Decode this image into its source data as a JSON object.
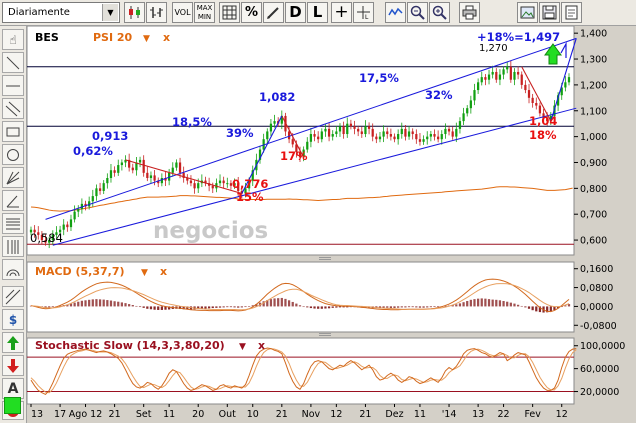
{
  "toolbar": {
    "period": "Diariamente",
    "vol": "VOL",
    "maxmin": "MAX MIN",
    "pct": "%",
    "d": "D",
    "l": "L"
  },
  "colors": {
    "up": "#11a011",
    "down": "#c82020",
    "channel": "#1a1adc",
    "psi": "#e06a10",
    "ref": "#9a1020",
    "anno_blue": "#1a1adc",
    "anno_red": "#e81010"
  },
  "chart_data": [
    {
      "type": "candlestick",
      "panel": "price",
      "title": "BES",
      "overlay_title": "PSI 20",
      "x_ticks": [
        "13",
        "17",
        "Ago 12",
        "21",
        "Set",
        "11",
        "20",
        "Out",
        "10",
        "21",
        "Nov",
        "12",
        "21",
        "Dez",
        "11",
        "'14",
        "13",
        "22",
        "Fev",
        "12"
      ],
      "y_ticks": [
        "0,600",
        "0,700",
        "0,800",
        "0,900",
        "1,000",
        "1,100",
        "1,200",
        "1,300",
        "1,400"
      ],
      "ylim": [
        0.55,
        1.42
      ],
      "close": [
        0.64,
        0.63,
        0.62,
        0.6,
        0.59,
        0.6,
        0.62,
        0.63,
        0.64,
        0.66,
        0.65,
        0.68,
        0.71,
        0.72,
        0.74,
        0.73,
        0.75,
        0.77,
        0.8,
        0.79,
        0.82,
        0.84,
        0.87,
        0.86,
        0.89,
        0.9,
        0.91,
        0.88,
        0.87,
        0.9,
        0.91,
        0.86,
        0.84,
        0.85,
        0.83,
        0.82,
        0.84,
        0.83,
        0.86,
        0.88,
        0.9,
        0.86,
        0.84,
        0.83,
        0.82,
        0.8,
        0.82,
        0.83,
        0.82,
        0.81,
        0.8,
        0.82,
        0.83,
        0.82,
        0.82,
        0.81,
        0.82,
        0.79,
        0.78,
        0.8,
        0.83,
        0.87,
        0.91,
        0.95,
        0.99,
        1.02,
        1.05,
        1.06,
        1.05,
        1.08,
        1.02,
        0.99,
        0.97,
        0.94,
        0.92,
        0.95,
        0.98,
        1.01,
        1.0,
        0.99,
        1.02,
        1.03,
        1.0,
        1.01,
        1.02,
        1.04,
        1.01,
        1.05,
        1.04,
        1.03,
        1.02,
        1.01,
        1.04,
        1.03,
        1.0,
        0.99,
        1.0,
        1.02,
        1.01,
        1.0,
        0.99,
        1.01,
        1.03,
        1.0,
        1.02,
        1.01,
        0.99,
        0.98,
        0.99,
        1.0,
        1.01,
        1.0,
        0.99,
        1.01,
        1.03,
        1.02,
        1.0,
        1.03,
        1.06,
        1.09,
        1.11,
        1.14,
        1.18,
        1.21,
        1.23,
        1.22,
        1.24,
        1.25,
        1.22,
        1.24,
        1.26,
        1.27,
        1.22,
        1.25,
        1.24,
        1.2,
        1.18,
        1.15,
        1.13,
        1.12,
        1.09,
        1.07,
        1.06,
        1.08,
        1.12,
        1.16,
        1.19,
        1.21,
        1.23
      ],
      "overlay": [
        0.728,
        0.727,
        0.725,
        0.722,
        0.719,
        0.716,
        0.714,
        0.713,
        0.712,
        0.713,
        0.713,
        0.714,
        0.716,
        0.718,
        0.72,
        0.723,
        0.725,
        0.728,
        0.731,
        0.734,
        0.736,
        0.739,
        0.742,
        0.744,
        0.747,
        0.749,
        0.752,
        0.754,
        0.757,
        0.759,
        0.762,
        0.764,
        0.766,
        0.766,
        0.766,
        0.766,
        0.767,
        0.767,
        0.768,
        0.769,
        0.77,
        0.772,
        0.772,
        0.772,
        0.771,
        0.771,
        0.77,
        0.769,
        0.768,
        0.767,
        0.766,
        0.765,
        0.765,
        0.764,
        0.763,
        0.762,
        0.761,
        0.759,
        0.758,
        0.757,
        0.757,
        0.757,
        0.757,
        0.757,
        0.757,
        0.758,
        0.758,
        0.758,
        0.758,
        0.758,
        0.758,
        0.759,
        0.758,
        0.758,
        0.757,
        0.756,
        0.756,
        0.755,
        0.754,
        0.753,
        0.754,
        0.755,
        0.756,
        0.757,
        0.757,
        0.758,
        0.76,
        0.761,
        0.761,
        0.761,
        0.761,
        0.762,
        0.763,
        0.764,
        0.764,
        0.765,
        0.766,
        0.768,
        0.769,
        0.771,
        0.772,
        0.773,
        0.774,
        0.775,
        0.776,
        0.777,
        0.778,
        0.779,
        0.78,
        0.781,
        0.782,
        0.783,
        0.784,
        0.785,
        0.787,
        0.788,
        0.789,
        0.79,
        0.791,
        0.792,
        0.793,
        0.794,
        0.795,
        0.796,
        0.797,
        0.799,
        0.801,
        0.803,
        0.805,
        0.806,
        0.806,
        0.806,
        0.805,
        0.805,
        0.804,
        0.803,
        0.802,
        0.801,
        0.8,
        0.798,
        0.796,
        0.794,
        0.792,
        0.792,
        0.792,
        0.793,
        0.794,
        0.795,
        0.798,
        0.801
      ],
      "levels": [
        0.584,
        1.04,
        1.27
      ],
      "annotations": {
        "low": "0,584",
        "a_913": "0,913",
        "a_062": "0,62%",
        "a_185": "18,5%",
        "a_39": "39%",
        "a_1082": "1,082",
        "a_175": "17,5%",
        "a_32": "32%",
        "a_1270": "1,270",
        "a_target": "+18%=1,497",
        "a_776": "0,776",
        "a_15": "15%",
        "a_17": "17%",
        "a_104": "1,04",
        "a_18": "18%"
      },
      "watermark": "negocios"
    },
    {
      "type": "histogram",
      "panel": "macd",
      "title": "MACD (5,37,7)",
      "y_ticks": [
        "0,1600",
        "0,0800",
        "0,0000",
        "-0,0800"
      ],
      "ylim": [
        -0.1,
        0.18
      ],
      "hist": [
        0.003,
        0.001,
        -0.002,
        -0.004,
        -0.005,
        -0.004,
        -0.002,
        0.0,
        0.003,
        0.006,
        0.008,
        0.012,
        0.016,
        0.02,
        0.024,
        0.026,
        0.028,
        0.03,
        0.031,
        0.03,
        0.029,
        0.027,
        0.025,
        0.022,
        0.02,
        0.017,
        0.014,
        0.01,
        0.006,
        0.002,
        -0.002,
        -0.006,
        -0.01,
        -0.012,
        -0.014,
        -0.015,
        -0.015,
        -0.014,
        -0.013,
        -0.011,
        -0.01,
        -0.011,
        -0.012,
        -0.013,
        -0.013,
        -0.012,
        -0.011,
        -0.01,
        -0.009,
        -0.008,
        -0.007,
        -0.006,
        -0.005,
        -0.004,
        -0.003,
        -0.003,
        -0.004,
        -0.005,
        -0.004,
        -0.002,
        0.001,
        0.005,
        0.01,
        0.016,
        0.022,
        0.027,
        0.031,
        0.034,
        0.035,
        0.036,
        0.032,
        0.026,
        0.019,
        0.012,
        0.005,
        0.0,
        -0.004,
        -0.007,
        -0.009,
        -0.01,
        -0.01,
        -0.009,
        -0.008,
        -0.006,
        -0.005,
        -0.004,
        -0.004,
        -0.004,
        -0.003,
        -0.003,
        -0.004,
        -0.005,
        -0.005,
        -0.006,
        -0.007,
        -0.007,
        -0.006,
        -0.005,
        -0.005,
        -0.006,
        -0.006,
        -0.005,
        -0.004,
        -0.004,
        -0.003,
        -0.003,
        -0.004,
        -0.005,
        -0.005,
        -0.004,
        -0.003,
        -0.002,
        -0.001,
        0.0,
        0.002,
        0.004,
        0.006,
        0.009,
        0.013,
        0.018,
        0.023,
        0.028,
        0.031,
        0.033,
        0.034,
        0.033,
        0.031,
        0.029,
        0.028,
        0.026,
        0.023,
        0.02,
        0.016,
        0.012,
        0.007,
        0.002,
        -0.004,
        -0.01,
        -0.016,
        -0.021,
        -0.024,
        -0.026,
        -0.025,
        -0.021,
        -0.015,
        -0.008,
        -0.002,
        0.004,
        0.01
      ],
      "macd_line": [
        0.004,
        0.0,
        -0.004,
        -0.008,
        -0.01,
        -0.009,
        -0.006,
        -0.002,
        0.004,
        0.011,
        0.018,
        0.027,
        0.038,
        0.05,
        0.062,
        0.072,
        0.081,
        0.089,
        0.096,
        0.1,
        0.102,
        0.103,
        0.102,
        0.099,
        0.095,
        0.09,
        0.083,
        0.075,
        0.066,
        0.057,
        0.047,
        0.038,
        0.029,
        0.021,
        0.014,
        0.008,
        0.003,
        0.0,
        -0.003,
        -0.005,
        -0.006,
        -0.008,
        -0.01,
        -0.012,
        -0.014,
        -0.015,
        -0.016,
        -0.017,
        -0.017,
        -0.018,
        -0.018,
        -0.018,
        -0.018,
        -0.017,
        -0.017,
        -0.017,
        -0.018,
        -0.019,
        -0.018,
        -0.015,
        -0.01,
        -0.002,
        0.009,
        0.022,
        0.037,
        0.052,
        0.065,
        0.077,
        0.087,
        0.095,
        0.098,
        0.097,
        0.092,
        0.084,
        0.074,
        0.063,
        0.052,
        0.042,
        0.033,
        0.025,
        0.018,
        0.012,
        0.008,
        0.005,
        0.003,
        0.002,
        0.001,
        0.001,
        0.0,
        -0.001,
        -0.002,
        -0.004,
        -0.005,
        -0.007,
        -0.009,
        -0.011,
        -0.012,
        -0.013,
        -0.013,
        -0.014,
        -0.014,
        -0.014,
        -0.013,
        -0.013,
        -0.012,
        -0.012,
        -0.012,
        -0.012,
        -0.012,
        -0.011,
        -0.01,
        -0.008,
        -0.005,
        -0.001,
        0.004,
        0.01,
        0.018,
        0.027,
        0.038,
        0.05,
        0.063,
        0.076,
        0.088,
        0.098,
        0.106,
        0.112,
        0.115,
        0.116,
        0.115,
        0.112,
        0.108,
        0.102,
        0.095,
        0.086,
        0.076,
        0.064,
        0.051,
        0.037,
        0.022,
        0.008,
        -0.005,
        -0.015,
        -0.021,
        -0.022,
        -0.017,
        -0.008,
        0.004,
        0.017,
        0.03
      ],
      "signal_line": [
        0.003,
        0.002,
        0.0,
        -0.003,
        -0.005,
        -0.006,
        -0.006,
        -0.005,
        -0.002,
        0.002,
        0.007,
        0.013,
        0.02,
        0.028,
        0.036,
        0.044,
        0.051,
        0.058,
        0.065,
        0.07,
        0.074,
        0.077,
        0.079,
        0.08,
        0.079,
        0.078,
        0.075,
        0.071,
        0.067,
        0.062,
        0.056,
        0.05,
        0.043,
        0.036,
        0.029,
        0.023,
        0.018,
        0.014,
        0.01,
        0.007,
        0.004,
        0.001,
        -0.001,
        -0.003,
        -0.005,
        -0.007,
        -0.009,
        -0.01,
        -0.011,
        -0.012,
        -0.013,
        -0.013,
        -0.013,
        -0.013,
        -0.013,
        -0.013,
        -0.013,
        -0.014,
        -0.014,
        -0.013,
        -0.011,
        -0.007,
        -0.001,
        0.006,
        0.015,
        0.025,
        0.034,
        0.043,
        0.052,
        0.059,
        0.066,
        0.071,
        0.073,
        0.073,
        0.069,
        0.063,
        0.056,
        0.048,
        0.041,
        0.035,
        0.028,
        0.022,
        0.016,
        0.011,
        0.007,
        0.005,
        0.004,
        0.004,
        0.003,
        0.002,
        0.001,
        0.0,
        -0.001,
        -0.002,
        -0.003,
        -0.005,
        -0.006,
        -0.007,
        -0.008,
        -0.009,
        -0.01,
        -0.011,
        -0.012,
        -0.012,
        -0.012,
        -0.012,
        -0.012,
        -0.012,
        -0.012,
        -0.012,
        -0.011,
        -0.01,
        -0.008,
        -0.006,
        -0.003,
        0.001,
        0.006,
        0.012,
        0.02,
        0.029,
        0.038,
        0.048,
        0.058,
        0.068,
        0.076,
        0.083,
        0.089,
        0.093,
        0.096,
        0.097,
        0.097,
        0.096,
        0.093,
        0.089,
        0.083,
        0.076,
        0.068,
        0.059,
        0.048,
        0.037,
        0.026,
        0.016,
        0.008,
        0.002,
        -0.001,
        -0.001,
        0.001,
        0.006,
        0.012
      ]
    },
    {
      "type": "line",
      "panel": "stochastic",
      "title": "Stochastic Slow (14,3,3,80,20)",
      "y_ticks": [
        "100,0000",
        "60,0000",
        "20,0000"
      ],
      "ylim": [
        0,
        110
      ],
      "k_line": [
        40,
        30,
        22,
        18,
        15,
        22,
        35,
        50,
        65,
        78,
        85,
        88,
        90,
        92,
        93,
        94,
        92,
        90,
        88,
        90,
        91,
        89,
        86,
        82,
        78,
        70,
        58,
        45,
        34,
        28,
        26,
        30,
        36,
        34,
        28,
        24,
        30,
        40,
        52,
        58,
        55,
        45,
        34,
        26,
        22,
        24,
        28,
        32,
        30,
        26,
        22,
        24,
        30,
        32,
        28,
        26,
        30,
        28,
        26,
        32,
        48,
        66,
        82,
        90,
        94,
        96,
        95,
        92,
        90,
        86,
        70,
        52,
        38,
        28,
        24,
        34,
        50,
        64,
        72,
        74,
        72,
        66,
        60,
        58,
        62,
        66,
        64,
        70,
        74,
        70,
        64,
        58,
        62,
        66,
        58,
        46,
        40,
        42,
        48,
        52,
        48,
        40,
        36,
        40,
        46,
        44,
        38,
        34,
        36,
        40,
        44,
        40,
        36,
        44,
        56,
        62,
        58,
        64,
        74,
        86,
        92,
        94,
        95,
        92,
        88,
        86,
        82,
        80,
        84,
        88,
        86,
        74,
        78,
        84,
        88,
        86,
        84,
        72,
        58,
        44,
        34,
        26,
        22,
        22,
        26,
        40,
        62,
        80,
        90,
        94,
        95
      ],
      "d_line": [
        44,
        38,
        30,
        24,
        19,
        18,
        24,
        35,
        49,
        63,
        75,
        83,
        87,
        90,
        91,
        93,
        93,
        92,
        90,
        89,
        89,
        89,
        88,
        85,
        82,
        77,
        69,
        58,
        47,
        37,
        29,
        27,
        30,
        33,
        32,
        29,
        27,
        31,
        39,
        48,
        55,
        53,
        45,
        36,
        28,
        24,
        25,
        28,
        30,
        29,
        26,
        24,
        25,
        28,
        30,
        29,
        28,
        28,
        28,
        28,
        35,
        48,
        64,
        78,
        88,
        93,
        95,
        94,
        92,
        89,
        82,
        69,
        53,
        40,
        30,
        29,
        36,
        48,
        60,
        69,
        72,
        71,
        66,
        61,
        60,
        62,
        64,
        66,
        70,
        72,
        69,
        64,
        61,
        62,
        62,
        57,
        48,
        43,
        43,
        47,
        49,
        47,
        41,
        39,
        41,
        43,
        42,
        39,
        36,
        37,
        40,
        41,
        40,
        40,
        45,
        53,
        58,
        61,
        65,
        74,
        84,
        90,
        93,
        94,
        92,
        89,
        85,
        83,
        82,
        84,
        86,
        83,
        79,
        79,
        83,
        86,
        86,
        81,
        71,
        58,
        45,
        35,
        27,
        23,
        23,
        30,
        43,
        61,
        77,
        88,
        93
      ]
    }
  ]
}
